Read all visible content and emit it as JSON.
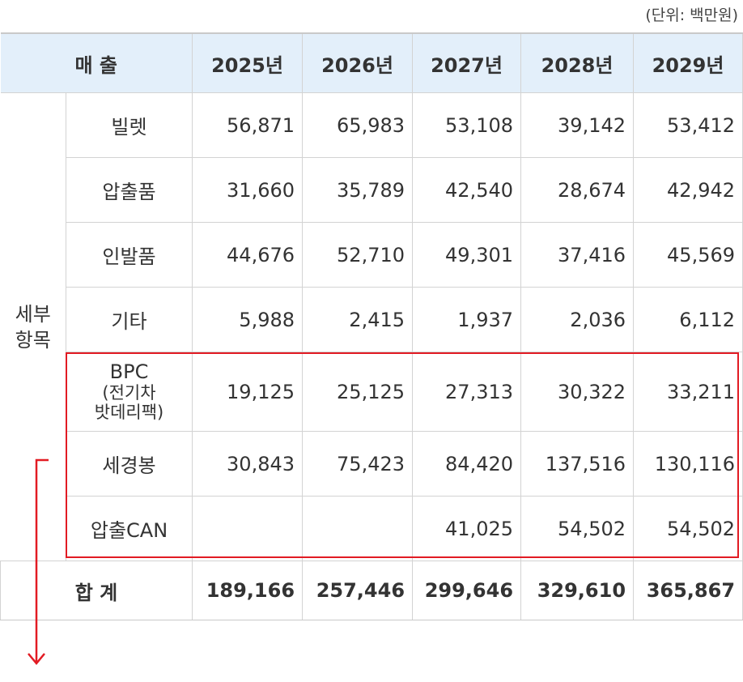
{
  "unit_note": "(단위: 백만원)",
  "header": {
    "first": "매 출",
    "years": [
      "2025년",
      "2026년",
      "2027년",
      "2028년",
      "2029년"
    ]
  },
  "group_label": "세부\n항목",
  "rows": [
    {
      "label": "빌렛",
      "values": [
        "56,871",
        "65,983",
        "53,108",
        "39,142",
        "53,412"
      ]
    },
    {
      "label": "압출품",
      "values": [
        "31,660",
        "35,789",
        "42,540",
        "28,674",
        "42,942"
      ]
    },
    {
      "label": "인발품",
      "values": [
        "44,676",
        "52,710",
        "49,301",
        "37,416",
        "45,569"
      ]
    },
    {
      "label": "기타",
      "values": [
        "5,988",
        "2,415",
        "1,937",
        "2,036",
        "6,112"
      ]
    },
    {
      "label": "BPC",
      "sublabel": "(전기차\n밧데리팩)",
      "values": [
        "19,125",
        "25,125",
        "27,313",
        "30,322",
        "33,211"
      ]
    },
    {
      "label": "세경봉",
      "values": [
        "30,843",
        "75,423",
        "84,420",
        "137,516",
        "130,116"
      ]
    },
    {
      "label": "압출CAN",
      "values": [
        "",
        "",
        "41,025",
        "54,502",
        "54,502"
      ]
    }
  ],
  "total": {
    "label": "합 계",
    "values": [
      "189,166",
      "257,446",
      "299,646",
      "329,610",
      "365,867"
    ]
  },
  "colors": {
    "header_bg": "#e3effa",
    "highlight": "#e21b23",
    "grid": "#d3d3d3"
  }
}
